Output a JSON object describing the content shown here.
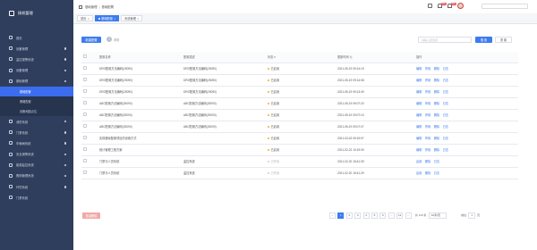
{
  "sidebar": {
    "logo": "接机管理",
    "items": [
      {
        "label": "首页",
        "arrow": false
      },
      {
        "label": "设备管理",
        "arrow": true
      },
      {
        "label": "监控报警系统",
        "arrow": true
      },
      {
        "label": "设备管理",
        "arrow": true
      },
      {
        "label": "基础管理",
        "arrow": true
      }
    ],
    "sub_items": [
      {
        "label": "基础配置",
        "active": true
      },
      {
        "label": "策略配置",
        "active": false
      },
      {
        "label": "设备地图点位",
        "active": false
      }
    ],
    "more_items": [
      {
        "label": "消防系统",
        "arrow": true
      },
      {
        "label": "门禁系统",
        "arrow": true
      },
      {
        "label": "车辆闸系统",
        "arrow": true
      },
      {
        "label": "安全报警系统",
        "arrow": true
      },
      {
        "label": "能源监控系统",
        "arrow": true
      },
      {
        "label": "照明管理系统",
        "arrow": true
      },
      {
        "label": "环境系统",
        "arrow": true
      },
      {
        "label": "门禁系统",
        "arrow": false
      }
    ]
  },
  "topbar": {
    "breadcrumb": [
      "基础管理",
      "基础配置"
    ],
    "badges": [
      "99+",
      "99+"
    ]
  },
  "tabs": [
    {
      "label": "首页",
      "active": false
    },
    {
      "label": "基础配置",
      "active": true
    },
    {
      "label": "系统管理",
      "active": false
    }
  ],
  "toolbar": {
    "new_label": "新建配置",
    "help_label": "帮助",
    "search_placeholder": "请输入配置项",
    "search_label": "搜 索",
    "reset_label": "重 置"
  },
  "table": {
    "headers": [
      "配置名称",
      "配置描述",
      "状态",
      "更新时间",
      "操作"
    ],
    "rows": [
      {
        "name": "DRD配置方法编码(25090)",
        "desc": "DRD配置方法编码(25090)",
        "status": "已启用",
        "enabled": true,
        "time": "2021-05-19 09:14:19",
        "ops": [
          "编辑",
          "停用",
          "删除",
          "日志"
        ]
      },
      {
        "name": "DRD配置方法编码(25090)",
        "desc": "DRD配置方法编码(25090)",
        "status": "已启用",
        "enabled": true,
        "time": "2021-05-19 09:14:08",
        "ops": [
          "编辑",
          "停用",
          "删除",
          "日志"
        ]
      },
      {
        "name": "DRD配置方法编码(25090)",
        "desc": "DRD配置方法编码(25090)",
        "status": "已启用",
        "enabled": true,
        "time": "2021-05-19 09:13:49",
        "ops": [
          "编辑",
          "停用",
          "删除",
          "日志"
        ]
      },
      {
        "name": "ABC配置方法编码(25090)",
        "desc": "ABC配置方法编码(25090)",
        "status": "已启用",
        "enabled": true,
        "time": "2021-05-19 09:07:20",
        "ops": [
          "编辑",
          "停用",
          "删除",
          "日志"
        ]
      },
      {
        "name": "ABC配置方法编码(25090)",
        "desc": "ABC配置方法编码(25090)",
        "status": "已启用",
        "enabled": true,
        "time": "2021-05-19 09:07:10",
        "ops": [
          "编辑",
          "停用",
          "删除",
          "日志"
        ]
      },
      {
        "name": "ABC配置方法编码(25090)",
        "desc": "ABC配置方法编码(25090)",
        "status": "已启用",
        "enabled": true,
        "time": "2021-05-19 09:07:07",
        "ops": [
          "编辑",
          "停用",
          "删除",
          "日志"
        ]
      },
      {
        "name": "实现基础配置项目的设置方式",
        "desc": "",
        "status": "已启用",
        "enabled": true,
        "time": "2021-03-02 09:19:57",
        "ops": [
          "编辑",
          "停用",
          "删除",
          "日志"
        ]
      },
      {
        "name": "统计管理工程方案",
        "desc": "",
        "status": "已启用",
        "enabled": true,
        "time": "2021-02-22 10:19:09",
        "ops": [
          "编辑",
          "停用",
          "删除",
          "日志"
        ]
      },
      {
        "name": "门禁与人员系统",
        "desc": "监控系统",
        "status": "已停用",
        "enabled": false,
        "time": "2021-02-20 15:41:39",
        "ops": [
          "启用",
          "删除",
          "日志"
        ]
      },
      {
        "name": "门禁与人员系统",
        "desc": "监控系统",
        "status": "已停用",
        "enabled": false,
        "time": "2021-02-20 15:41:29",
        "ops": [
          "启用",
          "删除",
          "日志"
        ]
      }
    ]
  },
  "footer": {
    "delete_label": "批量删除",
    "prev": "‹",
    "pages": [
      "1",
      "2",
      "3",
      "4",
      "5",
      "6",
      "...",
      "12"
    ],
    "next": "›",
    "total": "共 118 条",
    "page_size": "10条/页",
    "jump_label": "前往",
    "jump_value": "1",
    "jump_suffix": "页"
  },
  "colors": {
    "sidebar_bg": "#2f3e5c",
    "accent": "#3c7cf0",
    "status_on": "#f0ad2c",
    "danger": "#e8484b"
  }
}
